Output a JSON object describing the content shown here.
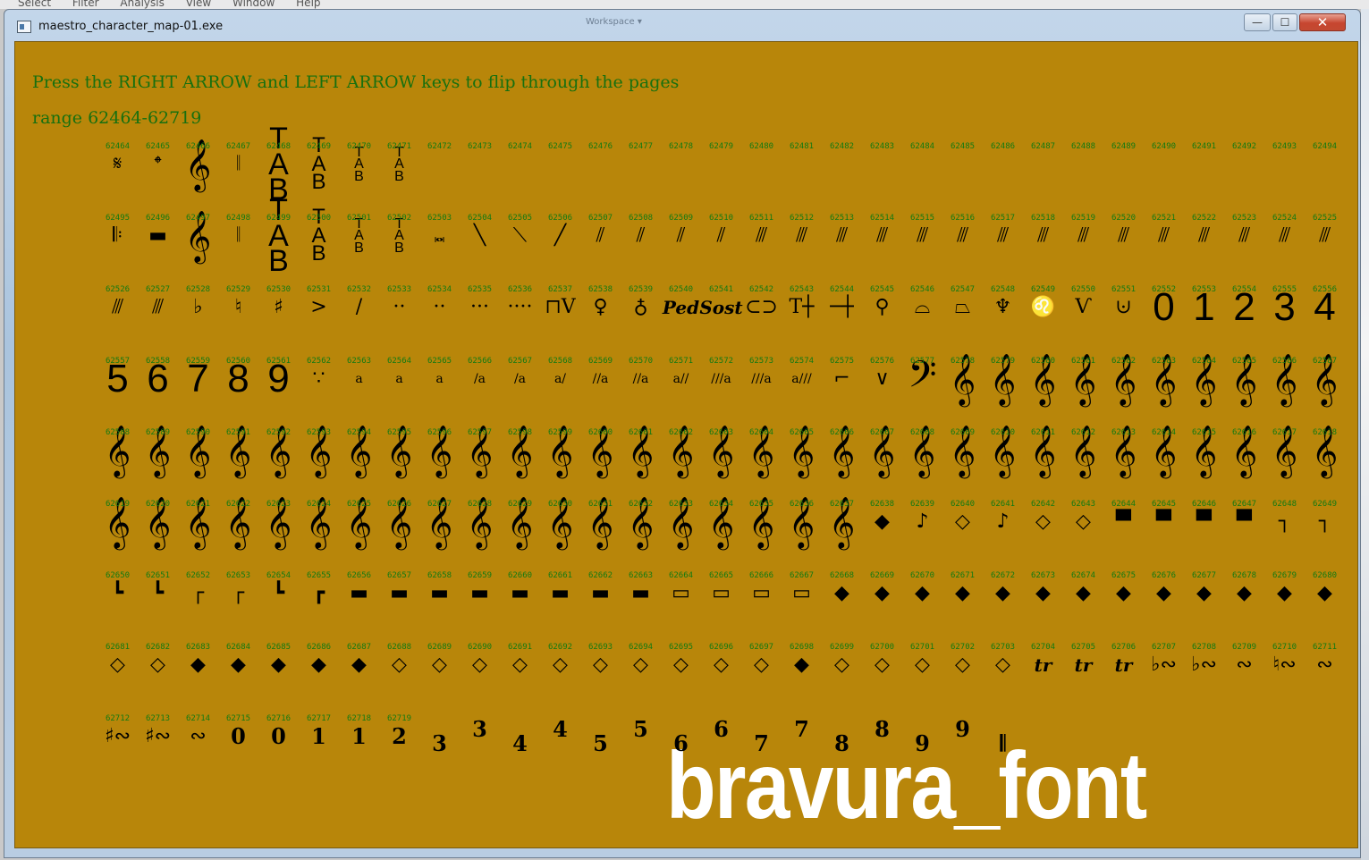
{
  "window": {
    "title": "maestro_character_map-01.exe",
    "background_menu": [
      "Select",
      "Filter",
      "Analysis",
      "View",
      "Window",
      "Help"
    ],
    "titlebar_ghost_text": "Workspace ▾",
    "controls": {
      "minimize": "—",
      "maximize": "☐",
      "close": "✕"
    }
  },
  "colors": {
    "client_background": "#b8860a",
    "instruction_text": "#17700f",
    "code_text": "#127a12",
    "glyph": "#000000",
    "font_caption": "#ffffff"
  },
  "header": {
    "instructions": "Press the RIGHT ARROW and LEFT ARROW keys to flip through the pages",
    "range": "range 62464-62719"
  },
  "font_caption": "bravura_font",
  "codes": {
    "start": 62464,
    "end": 62719,
    "per_row": 31
  },
  "glyphs": {
    "62464": "𝄋",
    "62465": "𝄌",
    "62466": "𝄞",
    "62467": "𝄁",
    "62468": "TAB",
    "62469": "TAB",
    "62470": "TAB",
    "62471": "TAB",
    "62495": "𝄆",
    "62496": "▬",
    "62497": "𝄞",
    "62498": "𝄁",
    "62499": "TAB",
    "62500": "TAB",
    "62501": "TAB",
    "62502": "TAB",
    "62503": "𝅜",
    "62504": "╲",
    "62505": "⟍",
    "62506": "╱",
    "62507": "⫽",
    "62508": "⫽",
    "62509": "⫽",
    "62510": "⫽",
    "62511": "⫻",
    "62512": "⫻",
    "62513": "⫻",
    "62514": "⫻",
    "62515": "⫻",
    "62516": "⫻",
    "62517": "⫻",
    "62518": "⫻",
    "62519": "⫻",
    "62520": "⫻",
    "62521": "⫻",
    "62522": "⫻",
    "62523": "⫻",
    "62524": "⫻",
    "62525": "⫻",
    "62526": "⫻",
    "62527": "⫻",
    "62528": "♭",
    "62529": "♮",
    "62530": "♯",
    "62531": ">",
    "62532": "/",
    "62533": "··",
    "62534": "··",
    "62535": "···",
    "62536": "····",
    "62537": "⊓V",
    "62538": "♀",
    "62539": "♁",
    "62540": "Ped",
    "62541": "Sost",
    "62542": "⊂⊃",
    "62543": "T┼",
    "62544": "─┼",
    "62545": "⚲",
    "62546": "⌓",
    "62547": "⏢",
    "62548": "♆",
    "62549": "♌",
    "62550": "Ѵ",
    "62551": "⊍",
    "62552": "0",
    "62553": "1",
    "62554": "2",
    "62555": "3",
    "62556": "4",
    "62557": "5",
    "62558": "6",
    "62559": "7",
    "62560": "8",
    "62561": "9",
    "62562": "∵",
    "62563": "a",
    "62564": "a",
    "62565": "a",
    "62566": "/a",
    "62567": "/a",
    "62568": "a/",
    "62569": "//a",
    "62570": "//a",
    "62571": "a//",
    "62572": "///a",
    "62573": "///a",
    "62574": "a///",
    "62575": "⌐",
    "62576": "∨",
    "62577": "𝄢",
    "62578": "𝄞",
    "62579": "𝄞",
    "62580": "𝄞",
    "62581": "𝄞",
    "62582": "𝄞",
    "62583": "𝄞",
    "62584": "𝄞",
    "62585": "𝄞",
    "62586": "𝄞",
    "62587": "𝄞",
    "62588": "𝄞",
    "62589": "𝄞",
    "62590": "𝄞",
    "62591": "𝄞",
    "62592": "𝄞",
    "62593": "𝄞",
    "62594": "𝄞",
    "62595": "𝄞",
    "62596": "𝄞",
    "62597": "𝄞",
    "62598": "𝄞",
    "62599": "𝄞",
    "62600": "𝄞",
    "62601": "𝄞",
    "62602": "𝄞",
    "62603": "𝄞",
    "62604": "𝄞",
    "62605": "𝄞",
    "62606": "𝄞",
    "62607": "𝄞",
    "62608": "𝄞",
    "62609": "𝄞",
    "62610": "𝄞",
    "62611": "𝄞",
    "62612": "𝄞",
    "62613": "𝄞",
    "62614": "𝄞",
    "62615": "𝄞",
    "62616": "𝄞",
    "62617": "𝄞",
    "62618": "𝄞",
    "62619": "𝄞",
    "62620": "𝄞",
    "62621": "𝄞",
    "62622": "𝄞",
    "62623": "𝄞",
    "62624": "𝄞",
    "62625": "𝄞",
    "62626": "𝄞",
    "62627": "𝄞",
    "62628": "𝄞",
    "62629": "𝄞",
    "62630": "𝄞",
    "62631": "𝄞",
    "62632": "𝄞",
    "62633": "𝄞",
    "62634": "𝄞",
    "62635": "𝄞",
    "62636": "𝄞",
    "62637": "𝄞",
    "62638": "◆",
    "62639": "♪",
    "62640": "◇",
    "62641": "♪",
    "62642": "◇",
    "62643": "◇",
    "62644": "▀",
    "62645": "▀",
    "62646": "▀",
    "62647": "▀",
    "62648": "┐",
    "62649": "┐",
    "62650": "┗",
    "62651": "┗",
    "62652": "┌",
    "62653": "┌",
    "62654": "┗",
    "62655": "┏",
    "62656": "▬",
    "62657": "▬",
    "62658": "▬",
    "62659": "▬",
    "62660": "▬",
    "62661": "▬",
    "62662": "▬",
    "62663": "▬",
    "62664": "▭",
    "62665": "▭",
    "62666": "▭",
    "62667": "▭",
    "62668": "◆",
    "62669": "◆",
    "62670": "◆",
    "62671": "◆",
    "62672": "◆",
    "62673": "◆",
    "62674": "◆",
    "62675": "◆",
    "62676": "◆",
    "62677": "◆",
    "62678": "◆",
    "62679": "◆",
    "62680": "◆",
    "62681": "◇",
    "62682": "◇",
    "62683": "◆",
    "62684": "◆",
    "62685": "◆",
    "62686": "◆",
    "62687": "◆",
    "62688": "◇",
    "62689": "◇",
    "62690": "◇",
    "62691": "◇",
    "62692": "◇",
    "62693": "◇",
    "62694": "◇",
    "62695": "◇",
    "62696": "◇",
    "62697": "◇",
    "62698": "◆",
    "62699": "◇",
    "62700": "◇",
    "62701": "◇",
    "62702": "◇",
    "62703": "◇",
    "62704": "tr",
    "62705": "tr",
    "62706": "tr",
    "62707": "♭∾",
    "62708": "♭∾",
    "62709": "∾",
    "62710": "♮∾",
    "62711": "∾",
    "62712": "♯∾",
    "62713": "♯∾",
    "62714": "∾",
    "62715": "0",
    "62716": "0",
    "62717": "1",
    "62718": "1",
    "62719": "2"
  },
  "extra_glyphs": [
    "3",
    "3",
    "4",
    "4",
    "5",
    "5",
    "6",
    "6",
    "7",
    "7",
    "8",
    "8",
    "9",
    "9",
    "𝄃"
  ]
}
